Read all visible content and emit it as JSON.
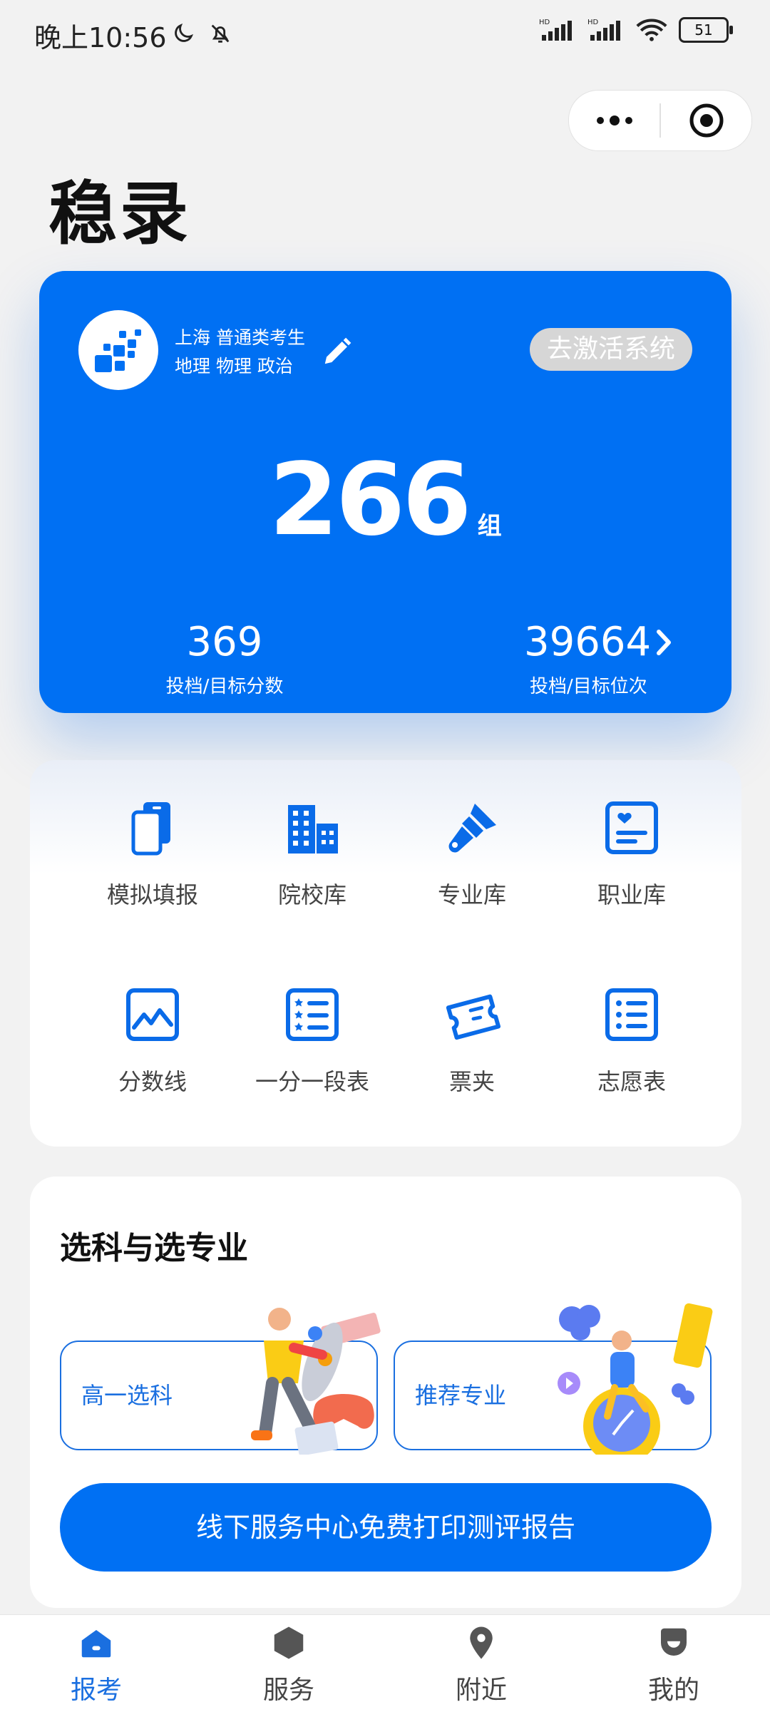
{
  "status_bar": {
    "time": "晚上10:56",
    "battery": "51"
  },
  "header": {
    "brand": "稳录"
  },
  "score_card": {
    "region": "上海 普通类考生",
    "subjects": "地理 物理 政治",
    "activate_label": "去激活系统",
    "group_count": "266",
    "group_unit": "组",
    "score_value": "369",
    "score_label": "投档/目标分数",
    "rank_value": "39664",
    "rank_label": "投档/目标位次"
  },
  "tools": [
    {
      "label": "模拟填报",
      "icon": "phone-copy-icon"
    },
    {
      "label": "院校库",
      "icon": "buildings-icon"
    },
    {
      "label": "专业库",
      "icon": "brush-icon"
    },
    {
      "label": "职业库",
      "icon": "profile-card-icon"
    },
    {
      "label": "分数线",
      "icon": "line-chart-icon"
    },
    {
      "label": "一分一段表",
      "icon": "star-list-icon"
    },
    {
      "label": "票夹",
      "icon": "ticket-icon"
    },
    {
      "label": "志愿表",
      "icon": "list-icon"
    }
  ],
  "selection": {
    "title": "选科与选专业",
    "option1": "高一选科",
    "option2": "推荐专业",
    "print_button": "线下服务中心免费打印测评报告"
  },
  "bottom_nav": {
    "items": [
      {
        "label": "报考",
        "icon": "home-icon",
        "active": true
      },
      {
        "label": "服务",
        "icon": "hexagon-icon",
        "active": false
      },
      {
        "label": "附近",
        "icon": "location-pin-icon",
        "active": false
      },
      {
        "label": "我的",
        "icon": "user-icon",
        "active": false
      }
    ]
  },
  "colors": {
    "primary": "#0070f3",
    "nav_active": "#1a6fe0",
    "background": "#f2f2f2"
  }
}
